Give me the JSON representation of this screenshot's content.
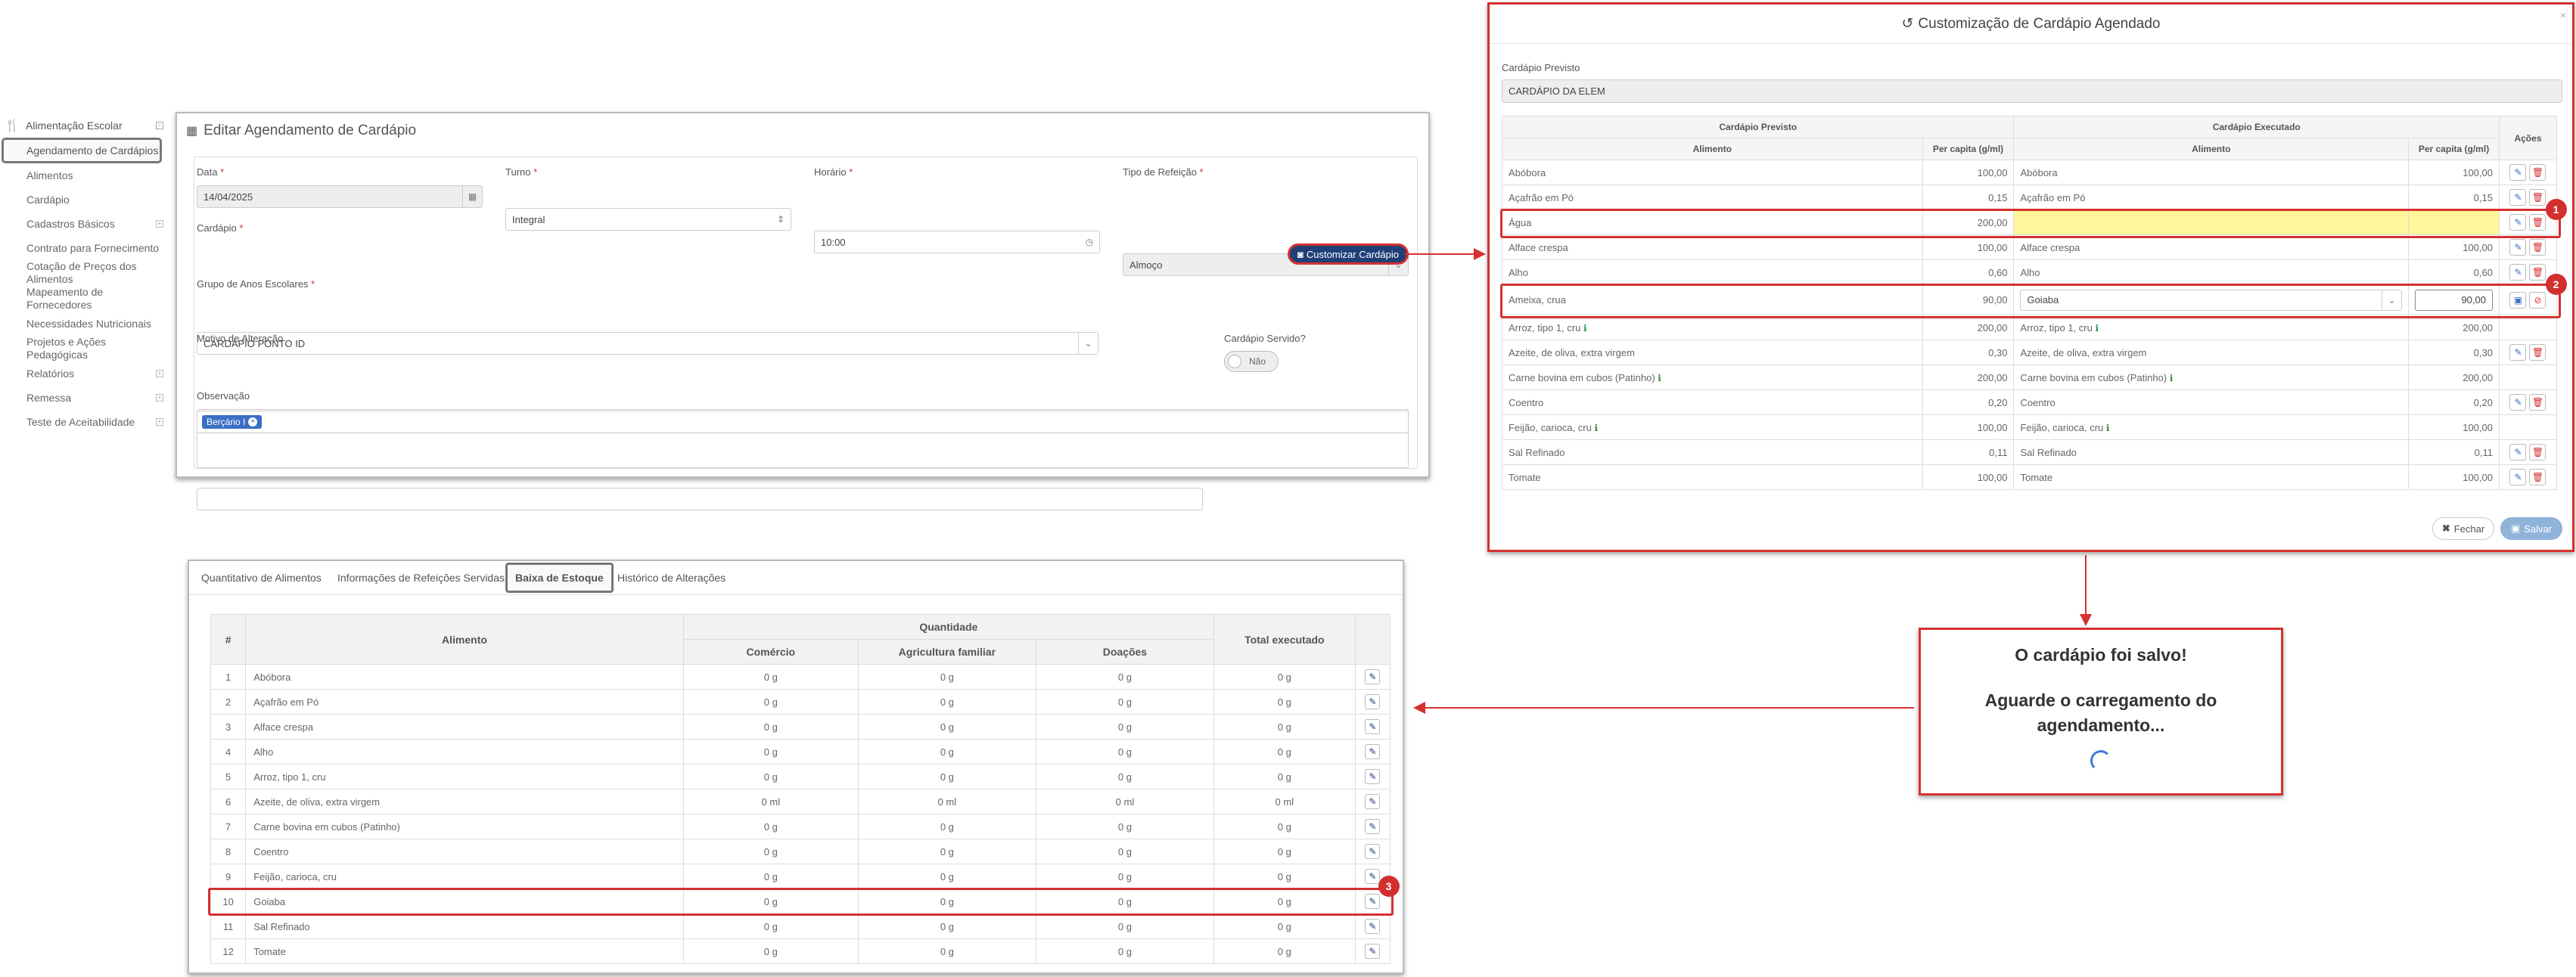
{
  "sidebar": {
    "title": "Alimentação Escolar",
    "items": [
      {
        "label": "Agendamento de Cardápios",
        "active": true,
        "plus": false
      },
      {
        "label": "Alimentos",
        "plus": false
      },
      {
        "label": "Cardápio",
        "plus": false
      },
      {
        "label": "Cadastros Básicos",
        "plus": true
      },
      {
        "label": "Contrato para Fornecimento",
        "plus": false
      },
      {
        "label": "Cotação de Preços dos Alimentos",
        "plus": false
      },
      {
        "label": "Mapeamento de Fornecedores",
        "plus": false
      },
      {
        "label": "Necessidades Nutricionais",
        "plus": false
      },
      {
        "label": "Projetos e Ações Pedagógicas",
        "plus": false
      },
      {
        "label": "Relatórios",
        "plus": true
      },
      {
        "label": "Remessa",
        "plus": true
      },
      {
        "label": "Teste de Aceitabilidade",
        "plus": true
      }
    ]
  },
  "edit": {
    "title": "Editar Agendamento de Cardápio",
    "data_label": "Data",
    "data_value": "14/04/2025",
    "turno_label": "Turno",
    "turno_value": "Integral",
    "horario_label": "Horário",
    "horario_value": "10:00",
    "tipo_label": "Tipo de Refeição",
    "tipo_value": "Almoço",
    "cardapio_label": "Cardápio",
    "cardapio_value": "CARDÁPIO PONTO ID",
    "customize_btn": "Customizar Cardápio",
    "grupo_label": "Grupo de Anos Escolares",
    "grupo_tag": "Berçário I",
    "motivo_label": "Motivo de Alteração",
    "servido_label": "Cardápio Servido?",
    "servido_value": "Não",
    "obs_label": "Observação"
  },
  "modal": {
    "title": "Customização de Cardápio Agendado",
    "prev_label": "Cardápio Previsto",
    "prev_value": "CARDÁPIO DA ELEM",
    "h_prev": "Cardápio Previsto",
    "h_exec": "Cardápio Executado",
    "h_acoes": "Ações",
    "h_alimento": "Alimento",
    "h_percap": "Per capita (g/ml)",
    "rows": [
      {
        "a": "Abóbora",
        "p": "100,00",
        "ea": "Abóbora",
        "ep": "100,00",
        "act": "ed"
      },
      {
        "a": "Açafrão em Pó",
        "p": "0,15",
        "ea": "Açafrão em Pó",
        "ep": "0,15",
        "act": "ed"
      },
      {
        "a": "Água",
        "p": "200,00",
        "ea": "",
        "ep": "",
        "act": "ed",
        "hl": "yellow",
        "badge": "1"
      },
      {
        "a": "Alface crespa",
        "p": "100,00",
        "ea": "Alface crespa",
        "ep": "100,00",
        "act": "ed"
      },
      {
        "a": "Alho",
        "p": "0,60",
        "ea": "Alho",
        "ep": "0,60",
        "act": "ed"
      },
      {
        "a": "Ameixa, crua",
        "p": "90,00",
        "ea": "Goiaba",
        "ep": "90,00",
        "act": "sc",
        "edit": true,
        "badge": "2"
      },
      {
        "a": "Arroz, tipo 1, cru",
        "p": "200,00",
        "ea": "Arroz, tipo 1, cru",
        "ep": "200,00",
        "act": "",
        "info": true
      },
      {
        "a": "Azeite, de oliva, extra virgem",
        "p": "0,30",
        "ea": "Azeite, de oliva, extra virgem",
        "ep": "0,30",
        "act": "ed"
      },
      {
        "a": "Carne bovina em cubos (Patinho)",
        "p": "200,00",
        "ea": "Carne bovina em cubos (Patinho)",
        "ep": "200,00",
        "act": "",
        "info": true
      },
      {
        "a": "Coentro",
        "p": "0,20",
        "ea": "Coentro",
        "ep": "0,20",
        "act": "ed"
      },
      {
        "a": "Feijão, carioca, cru",
        "p": "100,00",
        "ea": "Feijão, carioca, cru",
        "ep": "100,00",
        "act": "",
        "info": true
      },
      {
        "a": "Sal Refinado",
        "p": "0,11",
        "ea": "Sal Refinado",
        "ep": "0,11",
        "act": "ed"
      },
      {
        "a": "Tomate",
        "p": "100,00",
        "ea": "Tomate",
        "ep": "100,00",
        "act": "ed"
      }
    ],
    "close_btn": "Fechar",
    "save_btn": "Salvar"
  },
  "toast": {
    "line1": "O cardápio foi salvo!",
    "line2": "Aguarde o carregamento do agendamento..."
  },
  "bottom": {
    "tabs": [
      "Quantitativo de Alimentos",
      "Informações de Refeições Servidas",
      "Baixa de Estoque",
      "Histórico de Alterações"
    ],
    "h_num": "#",
    "h_alimento": "Alimento",
    "h_qtd": "Quantidade",
    "h_com": "Comércio",
    "h_agr": "Agricultura familiar",
    "h_doa": "Doações",
    "h_total": "Total executado",
    "rows": [
      {
        "n": "1",
        "a": "Abóbora",
        "c": "0 g",
        "g": "0 g",
        "d": "0 g",
        "t": "0 g"
      },
      {
        "n": "2",
        "a": "Açafrão em Pó",
        "c": "0 g",
        "g": "0 g",
        "d": "0 g",
        "t": "0 g"
      },
      {
        "n": "3",
        "a": "Alface crespa",
        "c": "0 g",
        "g": "0 g",
        "d": "0 g",
        "t": "0 g"
      },
      {
        "n": "4",
        "a": "Alho",
        "c": "0 g",
        "g": "0 g",
        "d": "0 g",
        "t": "0 g"
      },
      {
        "n": "5",
        "a": "Arroz, tipo 1, cru",
        "c": "0 g",
        "g": "0 g",
        "d": "0 g",
        "t": "0 g"
      },
      {
        "n": "6",
        "a": "Azeite, de oliva, extra virgem",
        "c": "0 ml",
        "g": "0 ml",
        "d": "0 ml",
        "t": "0 ml"
      },
      {
        "n": "7",
        "a": "Carne bovina em cubos (Patinho)",
        "c": "0 g",
        "g": "0 g",
        "d": "0 g",
        "t": "0 g"
      },
      {
        "n": "8",
        "a": "Coentro",
        "c": "0 g",
        "g": "0 g",
        "d": "0 g",
        "t": "0 g"
      },
      {
        "n": "9",
        "a": "Feijão, carioca, cru",
        "c": "0 g",
        "g": "0 g",
        "d": "0 g",
        "t": "0 g"
      },
      {
        "n": "10",
        "a": "Goiaba",
        "c": "0 g",
        "g": "0 g",
        "d": "0 g",
        "t": "0 g",
        "badge": "3"
      },
      {
        "n": "11",
        "a": "Sal Refinado",
        "c": "0 g",
        "g": "0 g",
        "d": "0 g",
        "t": "0 g"
      },
      {
        "n": "12",
        "a": "Tomate",
        "c": "0 g",
        "g": "0 g",
        "d": "0 g",
        "t": "0 g"
      }
    ]
  },
  "colors": {
    "accent_red": "#d63030",
    "primary": "#1f3f77",
    "yellow": "#fff79a"
  }
}
